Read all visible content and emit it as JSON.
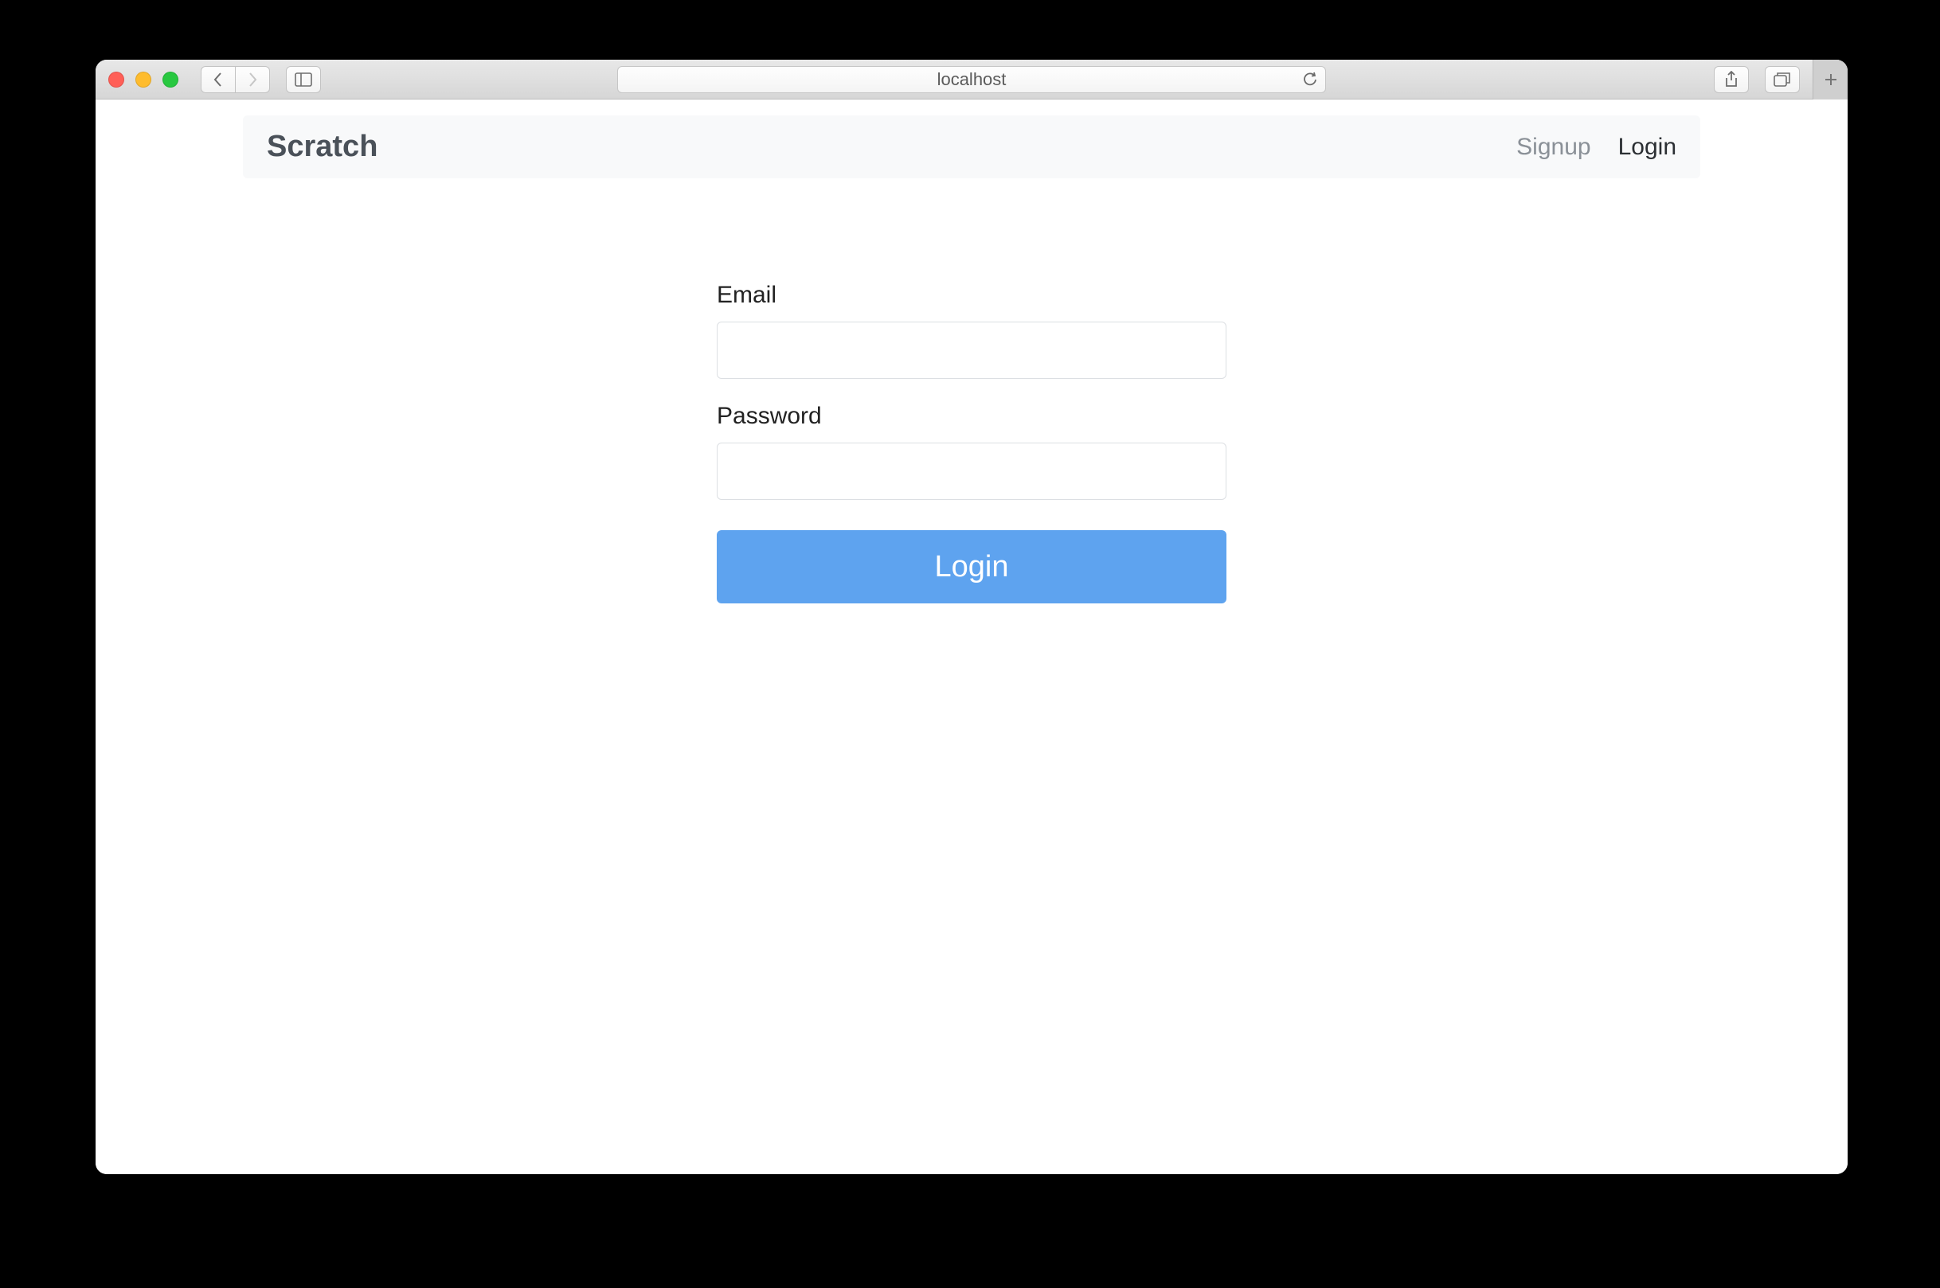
{
  "browser": {
    "address": "localhost"
  },
  "navbar": {
    "brand": "Scratch",
    "signup": "Signup",
    "login": "Login"
  },
  "form": {
    "email_label": "Email",
    "email_value": "",
    "password_label": "Password",
    "password_value": "",
    "submit_label": "Login"
  }
}
